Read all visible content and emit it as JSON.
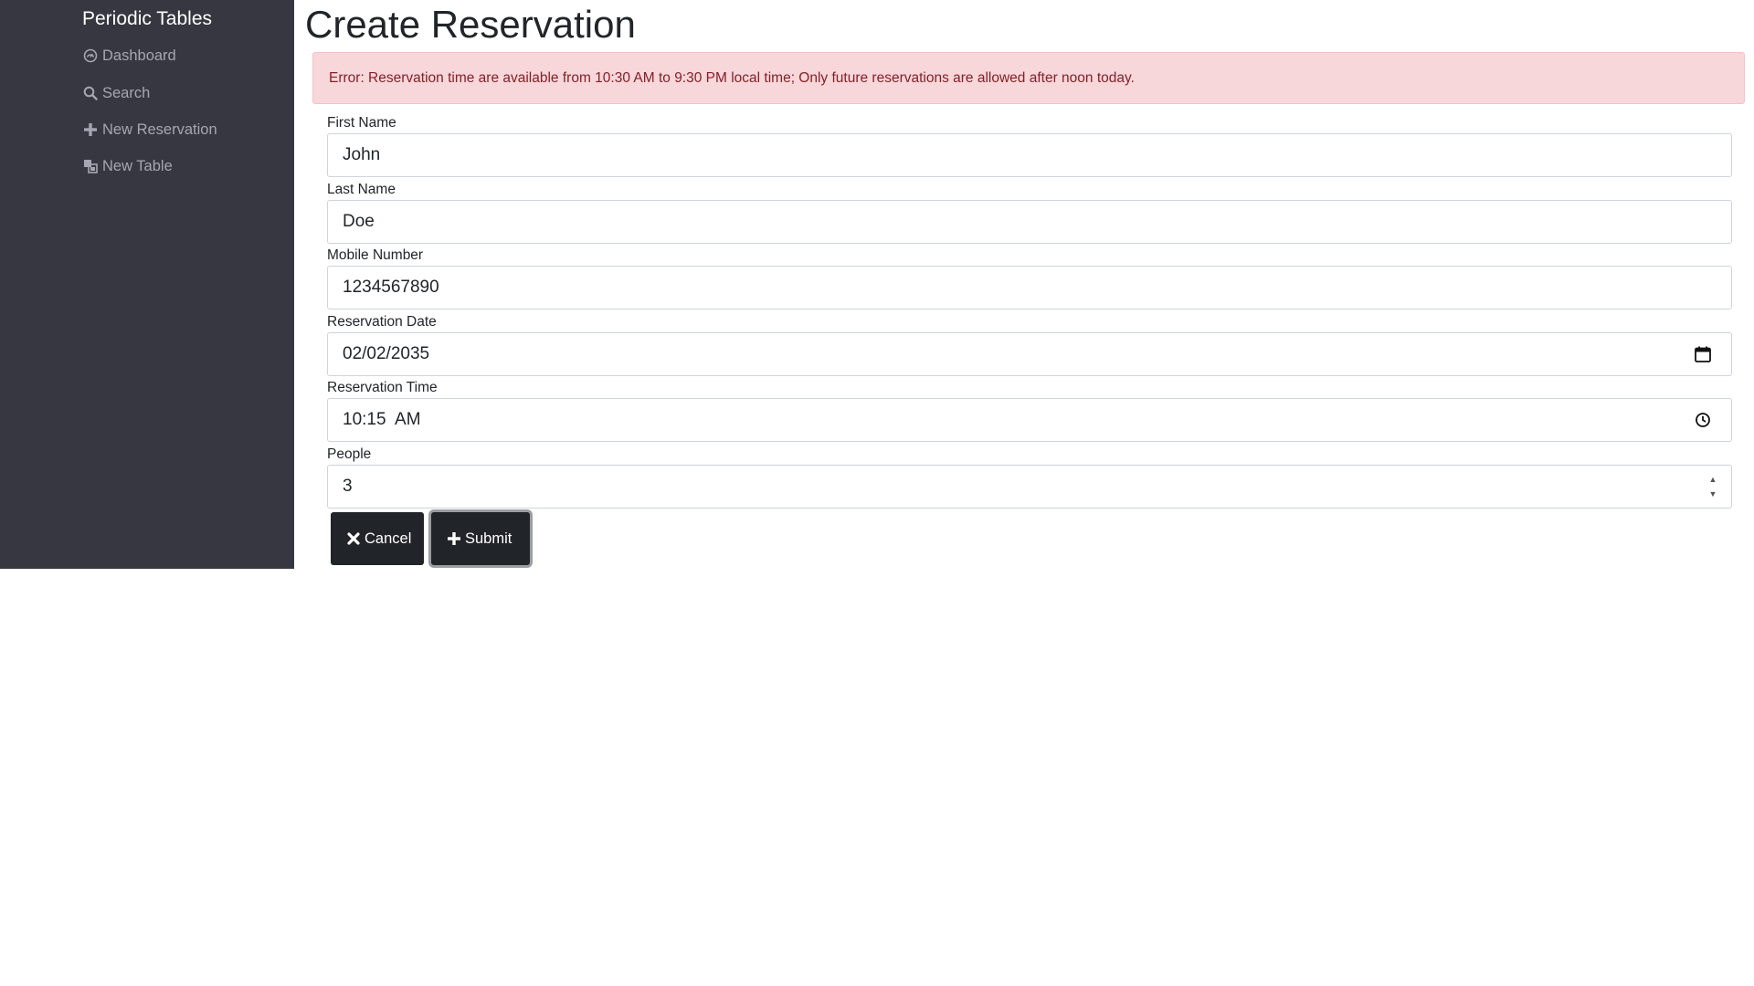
{
  "sidebar": {
    "brand": "Periodic Tables",
    "items": [
      {
        "label": "Dashboard",
        "icon": "dashboard-icon"
      },
      {
        "label": "Search",
        "icon": "search-icon"
      },
      {
        "label": "New Reservation",
        "icon": "plus-icon"
      },
      {
        "label": "New Table",
        "icon": "table-icon"
      }
    ]
  },
  "main": {
    "title": "Create Reservation",
    "error": "Error: Reservation time are available from 10:30 AM to 9:30 PM local time; Only future reservations are allowed after noon today.",
    "form": {
      "first_name": {
        "label": "First Name",
        "value": "John"
      },
      "last_name": {
        "label": "Last Name",
        "value": "Doe"
      },
      "mobile_number": {
        "label": "Mobile Number",
        "value": "1234567890"
      },
      "reservation_date": {
        "label": "Reservation Date",
        "value": "02/02/2035"
      },
      "reservation_time": {
        "label": "Reservation Time",
        "value": "10:15  AM"
      },
      "people": {
        "label": "People",
        "value": "3"
      }
    },
    "buttons": {
      "cancel": "Cancel",
      "submit": "Submit"
    }
  },
  "colors": {
    "sidebar_bg": "#363740",
    "sidebar_text": "#a4a6b3",
    "alert_bg": "#f8d7da",
    "alert_text": "#842029",
    "button_bg": "#212529"
  }
}
